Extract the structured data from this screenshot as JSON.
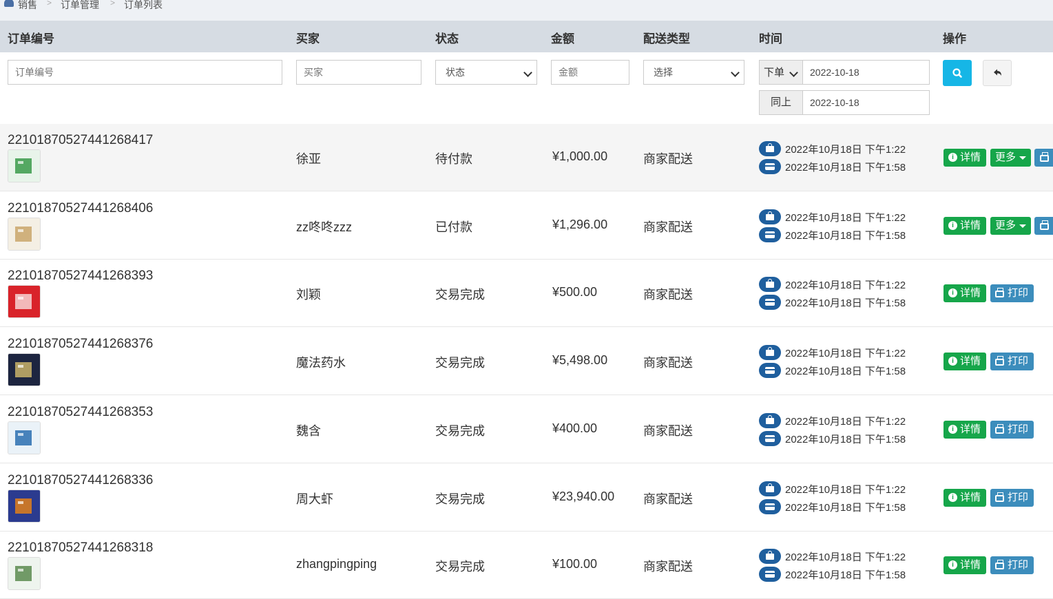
{
  "breadcrumb": {
    "items": [
      "销售",
      "订单管理",
      "订单列表"
    ],
    "separator": ">"
  },
  "table": {
    "headers": {
      "order_no": "订单编号",
      "buyer": "买家",
      "status": "状态",
      "amount": "金额",
      "delivery": "配送类型",
      "time": "时间",
      "actions": "操作"
    }
  },
  "filters": {
    "order_no_placeholder": "订单编号",
    "buyer_placeholder": "买家",
    "status_select": "状态",
    "amount_placeholder": "金额",
    "delivery_select": "选择",
    "time_type_select": "下单",
    "date_from": "2022-10-18",
    "same_label": "同上",
    "date_to": "2022-10-18"
  },
  "icons": {
    "search": "search-icon",
    "reset": "undo-icon",
    "order_time": "shopping-bag-icon",
    "pay_time": "credit-card-icon",
    "detail": "info-circle-icon",
    "print": "printer-icon"
  },
  "colors": {
    "header_bg": "#d6dce3",
    "search_button": "#16b6e6",
    "detail_button": "#16a64a",
    "print_button": "#3c8dbc",
    "time_badge": "#1f5f9e"
  },
  "buttons": {
    "detail": "详情",
    "more": "更多",
    "print": "打印"
  },
  "orders": [
    {
      "order_no": "22101870527441268417",
      "buyer": "徐亚",
      "status": "待付款",
      "amount": "¥1,000.00",
      "delivery": "商家配送",
      "order_time": "2022年10月18日 下午1:22",
      "pay_time": "2022年10月18日 下午1:58",
      "actions": "more"
    },
    {
      "order_no": "22101870527441268406",
      "buyer": "zz咚咚zzz",
      "status": "已付款",
      "amount": "¥1,296.00",
      "delivery": "商家配送",
      "order_time": "2022年10月18日 下午1:22",
      "pay_time": "2022年10月18日 下午1:58",
      "actions": "more"
    },
    {
      "order_no": "22101870527441268393",
      "buyer": "刘颖",
      "status": "交易完成",
      "amount": "¥500.00",
      "delivery": "商家配送",
      "order_time": "2022年10月18日 下午1:22",
      "pay_time": "2022年10月18日 下午1:58",
      "actions": "print"
    },
    {
      "order_no": "22101870527441268376",
      "buyer": "魔法药水",
      "status": "交易完成",
      "amount": "¥5,498.00",
      "delivery": "商家配送",
      "order_time": "2022年10月18日 下午1:22",
      "pay_time": "2022年10月18日 下午1:58",
      "actions": "print"
    },
    {
      "order_no": "22101870527441268353",
      "buyer": "魏含",
      "status": "交易完成",
      "amount": "¥400.00",
      "delivery": "商家配送",
      "order_time": "2022年10月18日 下午1:22",
      "pay_time": "2022年10月18日 下午1:58",
      "actions": "print"
    },
    {
      "order_no": "22101870527441268336",
      "buyer": "周大虾",
      "status": "交易完成",
      "amount": "¥23,940.00",
      "delivery": "商家配送",
      "order_time": "2022年10月18日 下午1:22",
      "pay_time": "2022年10月18日 下午1:58",
      "actions": "print"
    },
    {
      "order_no": "22101870527441268318",
      "buyer": "zhangpingping",
      "status": "交易完成",
      "amount": "¥100.00",
      "delivery": "商家配送",
      "order_time": "2022年10月18日 下午1:22",
      "pay_time": "2022年10月18日 下午1:58",
      "actions": "print"
    }
  ]
}
